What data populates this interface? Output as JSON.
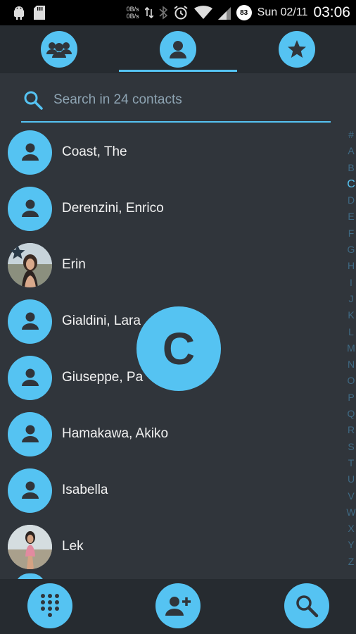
{
  "status_bar": {
    "net_up": "0B/s",
    "net_down": "0B/s",
    "battery": "83",
    "date": "Sun 02/11",
    "time": "03:06"
  },
  "tabs": [
    {
      "name": "groups",
      "icon": "groups-icon",
      "selected": false
    },
    {
      "name": "contacts",
      "icon": "person-icon",
      "selected": true
    },
    {
      "name": "favorites",
      "icon": "star-icon",
      "selected": false
    }
  ],
  "search": {
    "placeholder": "Search in 24 contacts",
    "value": ""
  },
  "contacts": [
    {
      "name": "Coast, The",
      "avatar": "default-avatar-icon"
    },
    {
      "name": "Derenzini, Enrico",
      "avatar": "default-avatar-icon"
    },
    {
      "name": "Erin",
      "avatar": "photo",
      "favorite": true
    },
    {
      "name": "Gialdini, Lara",
      "avatar": "default-avatar-icon"
    },
    {
      "name": "Giuseppe, Pa",
      "avatar": "default-avatar-icon"
    },
    {
      "name": "Hamakawa, Akiko",
      "avatar": "default-avatar-icon"
    },
    {
      "name": "Isabella",
      "avatar": "default-avatar-icon"
    },
    {
      "name": "Lek",
      "avatar": "photo"
    }
  ],
  "alphabet_index": [
    "#",
    "A",
    "B",
    "C",
    "D",
    "E",
    "F",
    "G",
    "H",
    "I",
    "J",
    "K",
    "L",
    "M",
    "N",
    "O",
    "P",
    "Q",
    "R",
    "S",
    "T",
    "U",
    "V",
    "W",
    "X",
    "Y",
    "Z"
  ],
  "active_letter": "C",
  "colors": {
    "accent": "#55c3f2",
    "background": "#30353b",
    "bar": "#262b30"
  },
  "bottom_actions": [
    {
      "name": "dialpad",
      "icon": "dialpad-icon"
    },
    {
      "name": "add-contact",
      "icon": "add-person-icon"
    },
    {
      "name": "search",
      "icon": "search-icon"
    }
  ]
}
